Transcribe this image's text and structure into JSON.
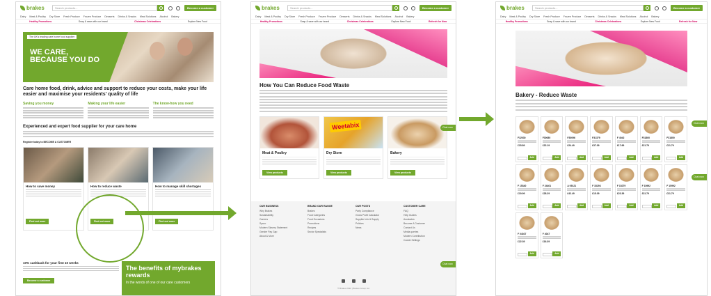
{
  "header": {
    "logo": "brakes",
    "search_placeholder": "Search products...",
    "become_customer": "Become a customer"
  },
  "nav": [
    "Dairy",
    "Meat & Poultry",
    "Dry Store",
    "Fresh Produce",
    "Frozen Produce",
    "Desserts",
    "Drinks & Snacks",
    "Meal Solutions",
    "Alcohol",
    "Bakery",
    "Deli",
    "Fish & Seafood",
    "Supplies & Equipment"
  ],
  "promo": [
    "Healthy Promotions",
    "Snap & save with our brand",
    "Christmas Celebrations",
    "Explore New Food",
    "Refresh for Now"
  ],
  "panel1": {
    "hero_tag": "The UK's leading care home food supplier",
    "hero_title_1": "WE CARE,",
    "hero_title_2": "BECAUSE YOU DO",
    "heading": "Care home food, drink, advice and support to reduce your costs, make your life easier and maximise your residents' quality of life",
    "col1_title": "Saving you money",
    "col2_title": "Making your life easier",
    "col3_title": "The know-how you need",
    "section_title": "Experienced and expert food supplier for your care home",
    "register": "Register today to BECOME A CUSTOMER",
    "card1_title": "How to save money",
    "card2_title": "How to reduce waste",
    "card3_title": "How to manage skill shortages",
    "find_out_more": "Find out more",
    "cash_title": "10% cashback for your first 10 weeks",
    "become_customer": "Become a customer",
    "benefits_big": "The benefits of mybrakes rewards",
    "benefits_small": "In the words of one of our care customers"
  },
  "panel2": {
    "heading": "How You Can Reduce Food Waste",
    "card1_title": "Meat & Poultry",
    "card2_title": "Dry Store",
    "card3_title": "Bakery",
    "card2_badge": "Weetabix",
    "view_products": "View products",
    "chat": "Chat now",
    "footer": [
      {
        "title": "OUR BUSINESS",
        "items": [
          "Why Brakes",
          "Sustainability",
          "Careers",
          "Sysco",
          "Modern Slavery Statement",
          "Gender Pay Gap",
          "About & More"
        ]
      },
      {
        "title": "BRAND OUR RANGE",
        "items": [
          "Brakes",
          "Food Categories",
          "Food Occasions",
          "Promotions",
          "Recipes",
          "Sector Specialists"
        ]
      },
      {
        "title": "OUR POSTS",
        "items": [
          "Party Compliance",
          "Gross Profit Calculator",
          "Supplier Info & Supply",
          "Policies",
          "News"
        ]
      },
      {
        "title": "CUSTOMER CARE",
        "items": [
          "FAQ",
          "Help Guides",
          "Accolades",
          "Become A Customer",
          "Contact Us",
          "Media queries",
          "Modern Contribution",
          "Cookie Settings"
        ]
      }
    ],
    "copyright": "© Brakes 2022 | Brakes Group Ltd"
  },
  "panel3": {
    "heading": "Bakery - Reduce Waste",
    "add": "Add",
    "products": [
      {
        "code": "F32030",
        "price": "£15.89"
      },
      {
        "code": "F30080",
        "price": "£22.19"
      },
      {
        "code": "F30096",
        "price": "£24.49"
      },
      {
        "code": "F31379",
        "price": "£37.09"
      },
      {
        "code": "F 4042",
        "price": "£17.69"
      },
      {
        "code": "F31800",
        "price": "£21.79"
      },
      {
        "code": "F31800",
        "price": "£21.79"
      },
      {
        "code": "F 15340",
        "price": "£19.99"
      },
      {
        "code": "F 24401",
        "price": "£28.29"
      },
      {
        "code": "A 09121",
        "price": "£42.49"
      },
      {
        "code": "F 33293",
        "price": "£15.09"
      },
      {
        "code": "F 15279",
        "price": "£23.39"
      },
      {
        "code": "F 15992",
        "price": "£31.79"
      },
      {
        "code": "F 15992",
        "price": "£31.79"
      },
      {
        "code": "F 04027",
        "price": "£22.39"
      },
      {
        "code": "F 4047",
        "price": "£16.39"
      }
    ]
  }
}
